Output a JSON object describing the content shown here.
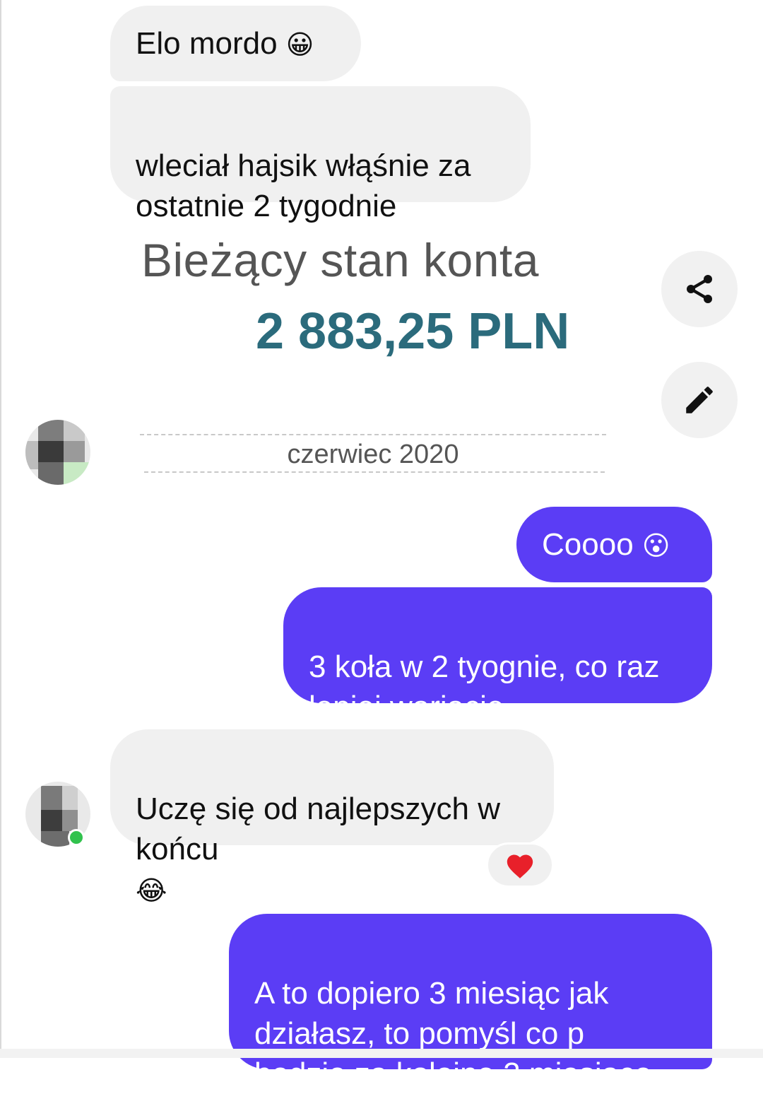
{
  "messages": [
    {
      "text": "Elo mordo",
      "emoji": "😀"
    },
    {
      "text": "wleciał hajsik włąśnie za\nostatnie 2 tygodnie"
    },
    {
      "text": "Coooo",
      "emoji": "😮"
    },
    {
      "text": "3 koła w 2 tyognie, co raz\nlepiej wariacie",
      "emoji": "😎 👊"
    },
    {
      "text": "Uczę się od najlepszych w\nkońcu",
      "emoji": "😂"
    },
    {
      "text": "A to dopiero 3 miesiąc jak\ndziałasz, to pomyśl co p\nbędzie za kolejne 3 miesiące"
    }
  ],
  "shared_image": {
    "title": "Bieżący stan konta",
    "amount": "2 883,25 PLN",
    "month": "czerwiec 2020"
  },
  "reaction": {
    "emoji": "❤️"
  },
  "icons": [
    "share-icon",
    "edit-pencil-icon",
    "heart-icon"
  ],
  "colors": {
    "incoming_bubble": "#f0f0f0",
    "outgoing_bubble": "#5b3df5",
    "amount_text": "#2b6b7c",
    "online": "#31c24d"
  }
}
